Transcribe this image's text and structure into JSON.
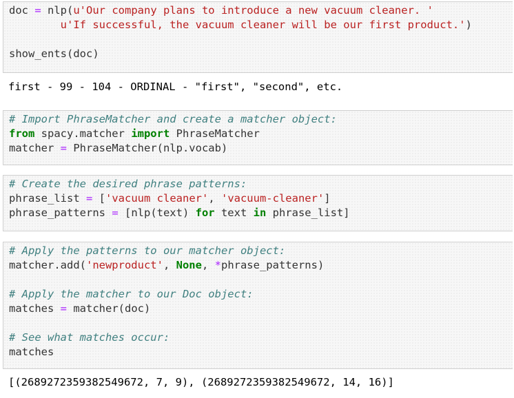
{
  "cells": [
    {
      "id": "cell1",
      "lines": [
        [
          "doc ",
          "=",
          " nlp(",
          "u'Our company plans to introduce a new vacuum cleaner. '"
        ],
        [
          "        ",
          "u'If successful, the vacuum cleaner will be our first product.'",
          ")"
        ],
        [
          ""
        ],
        [
          "show_ents(doc)"
        ]
      ],
      "output": "first - 99 - 104 - ORDINAL - \"first\", \"second\", etc."
    },
    {
      "id": "cell2",
      "lines": [
        [
          "# Import PhraseMatcher and create a matcher object:"
        ],
        [
          "from",
          " spacy.matcher ",
          "import",
          " PhraseMatcher"
        ],
        [
          "matcher ",
          "=",
          " PhraseMatcher(nlp.vocab)"
        ]
      ]
    },
    {
      "id": "cell3",
      "lines": [
        [
          "# Create the desired phrase patterns:"
        ],
        [
          "phrase_list ",
          "=",
          " [",
          "'vacuum cleaner'",
          ", ",
          "'vacuum-cleaner'",
          "]"
        ],
        [
          "phrase_patterns ",
          "=",
          " [nlp(text) ",
          "for",
          " text ",
          "in",
          " phrase_list]"
        ]
      ]
    },
    {
      "id": "cell4",
      "lines": [
        [
          "# Apply the patterns to our matcher object:"
        ],
        [
          "matcher.add(",
          "'newproduct'",
          ", ",
          "None",
          ", ",
          "*",
          "phrase_patterns)"
        ],
        [
          ""
        ],
        [
          "# Apply the matcher to our Doc object:"
        ],
        [
          "matches ",
          "=",
          " matcher(doc)"
        ],
        [
          ""
        ],
        [
          "# See what matches occur:"
        ],
        [
          "matches"
        ]
      ],
      "output": "[(2689272359382549672, 7, 9), (2689272359382549672, 14, 16)]"
    }
  ],
  "syntax_colors": {
    "string": "#ba2121",
    "operator": "#aa22ff",
    "comment": "#408080",
    "keyword": "#008000",
    "text": "#333333"
  }
}
